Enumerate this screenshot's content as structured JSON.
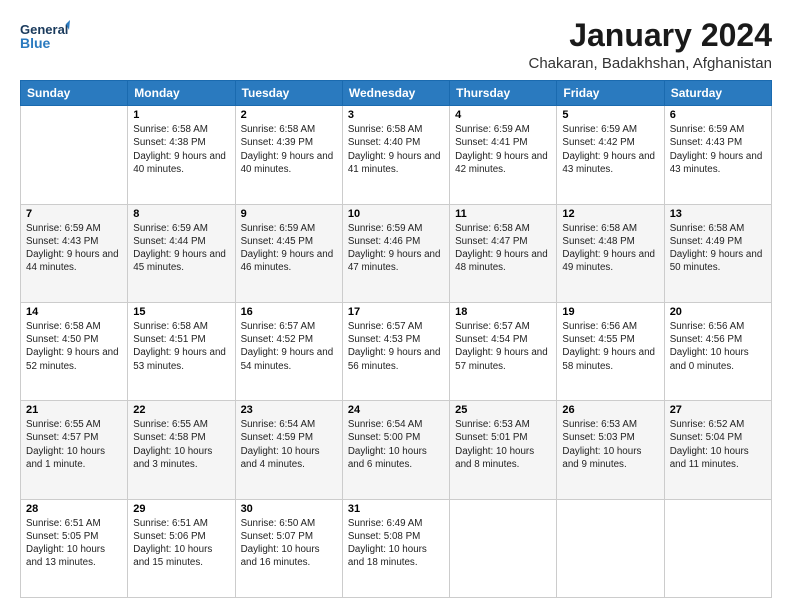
{
  "header": {
    "logo_line1": "General",
    "logo_line2": "Blue",
    "title": "January 2024",
    "subtitle": "Chakaran, Badakhshan, Afghanistan"
  },
  "days_of_week": [
    "Sunday",
    "Monday",
    "Tuesday",
    "Wednesday",
    "Thursday",
    "Friday",
    "Saturday"
  ],
  "weeks": [
    [
      {
        "day": "",
        "sunrise": "",
        "sunset": "",
        "daylight": ""
      },
      {
        "day": "1",
        "sunrise": "6:58 AM",
        "sunset": "4:38 PM",
        "daylight": "9 hours and 40 minutes."
      },
      {
        "day": "2",
        "sunrise": "6:58 AM",
        "sunset": "4:39 PM",
        "daylight": "9 hours and 40 minutes."
      },
      {
        "day": "3",
        "sunrise": "6:58 AM",
        "sunset": "4:40 PM",
        "daylight": "9 hours and 41 minutes."
      },
      {
        "day": "4",
        "sunrise": "6:59 AM",
        "sunset": "4:41 PM",
        "daylight": "9 hours and 42 minutes."
      },
      {
        "day": "5",
        "sunrise": "6:59 AM",
        "sunset": "4:42 PM",
        "daylight": "9 hours and 43 minutes."
      },
      {
        "day": "6",
        "sunrise": "6:59 AM",
        "sunset": "4:43 PM",
        "daylight": "9 hours and 43 minutes."
      }
    ],
    [
      {
        "day": "7",
        "sunrise": "6:59 AM",
        "sunset": "4:43 PM",
        "daylight": "9 hours and 44 minutes."
      },
      {
        "day": "8",
        "sunrise": "6:59 AM",
        "sunset": "4:44 PM",
        "daylight": "9 hours and 45 minutes."
      },
      {
        "day": "9",
        "sunrise": "6:59 AM",
        "sunset": "4:45 PM",
        "daylight": "9 hours and 46 minutes."
      },
      {
        "day": "10",
        "sunrise": "6:59 AM",
        "sunset": "4:46 PM",
        "daylight": "9 hours and 47 minutes."
      },
      {
        "day": "11",
        "sunrise": "6:58 AM",
        "sunset": "4:47 PM",
        "daylight": "9 hours and 48 minutes."
      },
      {
        "day": "12",
        "sunrise": "6:58 AM",
        "sunset": "4:48 PM",
        "daylight": "9 hours and 49 minutes."
      },
      {
        "day": "13",
        "sunrise": "6:58 AM",
        "sunset": "4:49 PM",
        "daylight": "9 hours and 50 minutes."
      }
    ],
    [
      {
        "day": "14",
        "sunrise": "6:58 AM",
        "sunset": "4:50 PM",
        "daylight": "9 hours and 52 minutes."
      },
      {
        "day": "15",
        "sunrise": "6:58 AM",
        "sunset": "4:51 PM",
        "daylight": "9 hours and 53 minutes."
      },
      {
        "day": "16",
        "sunrise": "6:57 AM",
        "sunset": "4:52 PM",
        "daylight": "9 hours and 54 minutes."
      },
      {
        "day": "17",
        "sunrise": "6:57 AM",
        "sunset": "4:53 PM",
        "daylight": "9 hours and 56 minutes."
      },
      {
        "day": "18",
        "sunrise": "6:57 AM",
        "sunset": "4:54 PM",
        "daylight": "9 hours and 57 minutes."
      },
      {
        "day": "19",
        "sunrise": "6:56 AM",
        "sunset": "4:55 PM",
        "daylight": "9 hours and 58 minutes."
      },
      {
        "day": "20",
        "sunrise": "6:56 AM",
        "sunset": "4:56 PM",
        "daylight": "10 hours and 0 minutes."
      }
    ],
    [
      {
        "day": "21",
        "sunrise": "6:55 AM",
        "sunset": "4:57 PM",
        "daylight": "10 hours and 1 minute."
      },
      {
        "day": "22",
        "sunrise": "6:55 AM",
        "sunset": "4:58 PM",
        "daylight": "10 hours and 3 minutes."
      },
      {
        "day": "23",
        "sunrise": "6:54 AM",
        "sunset": "4:59 PM",
        "daylight": "10 hours and 4 minutes."
      },
      {
        "day": "24",
        "sunrise": "6:54 AM",
        "sunset": "5:00 PM",
        "daylight": "10 hours and 6 minutes."
      },
      {
        "day": "25",
        "sunrise": "6:53 AM",
        "sunset": "5:01 PM",
        "daylight": "10 hours and 8 minutes."
      },
      {
        "day": "26",
        "sunrise": "6:53 AM",
        "sunset": "5:03 PM",
        "daylight": "10 hours and 9 minutes."
      },
      {
        "day": "27",
        "sunrise": "6:52 AM",
        "sunset": "5:04 PM",
        "daylight": "10 hours and 11 minutes."
      }
    ],
    [
      {
        "day": "28",
        "sunrise": "6:51 AM",
        "sunset": "5:05 PM",
        "daylight": "10 hours and 13 minutes."
      },
      {
        "day": "29",
        "sunrise": "6:51 AM",
        "sunset": "5:06 PM",
        "daylight": "10 hours and 15 minutes."
      },
      {
        "day": "30",
        "sunrise": "6:50 AM",
        "sunset": "5:07 PM",
        "daylight": "10 hours and 16 minutes."
      },
      {
        "day": "31",
        "sunrise": "6:49 AM",
        "sunset": "5:08 PM",
        "daylight": "10 hours and 18 minutes."
      },
      {
        "day": "",
        "sunrise": "",
        "sunset": "",
        "daylight": ""
      },
      {
        "day": "",
        "sunrise": "",
        "sunset": "",
        "daylight": ""
      },
      {
        "day": "",
        "sunrise": "",
        "sunset": "",
        "daylight": ""
      }
    ]
  ]
}
